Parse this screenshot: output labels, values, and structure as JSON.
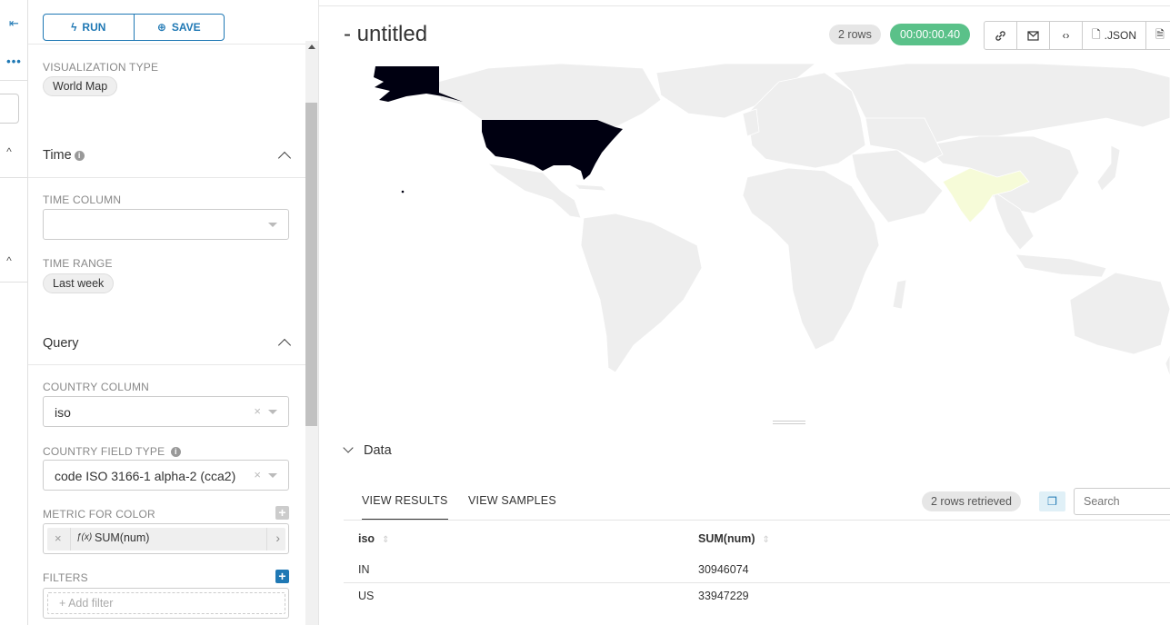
{
  "panel": {
    "run_label": "RUN",
    "save_label": "SAVE",
    "viz_type_label": "VISUALIZATION TYPE",
    "viz_type_value": "World Map",
    "time_section": "Time",
    "time_column_label": "TIME COLUMN",
    "time_column_value": "",
    "time_range_label": "TIME RANGE",
    "time_range_value": "Last week",
    "query_section": "Query",
    "country_column_label": "COUNTRY COLUMN",
    "country_column_value": "iso",
    "country_field_type_label": "COUNTRY FIELD TYPE",
    "country_field_type_value": "code ISO 3166-1 alpha-2 (cca2)",
    "metric_label": "METRIC FOR COLOR",
    "metric_value": "SUM(num)",
    "metric_fx": "ƒ(x)",
    "filters_label": "FILTERS",
    "add_filter_placeholder": "Add filter"
  },
  "header": {
    "title": "- untitled",
    "rows_badge": "2 rows",
    "timer": "00:00:00.40",
    "json_label": ".JSON"
  },
  "data_section": {
    "title": "Data",
    "tabs": [
      "VIEW RESULTS",
      "VIEW SAMPLES"
    ],
    "retrieved": "2 rows retrieved",
    "search_placeholder": "Search",
    "columns": [
      "iso",
      "SUM(num)"
    ],
    "rows": [
      [
        "IN",
        "30946074"
      ],
      [
        "US",
        "33947229"
      ]
    ]
  },
  "colors": {
    "accent": "#1f78b4",
    "timer": "#5ac189",
    "us": "#000011",
    "in": "#f6fbd8",
    "land": "#eeeeee"
  },
  "icons": {
    "collapse": "collapse-left-icon",
    "more": "more-dots-icon",
    "run": "bolt-icon",
    "save": "plus-circle-icon",
    "info": "info-icon",
    "link": "link-icon",
    "email": "mail-icon",
    "embed": "code-icon",
    "json": "file-icon",
    "csv": "file-icon",
    "copy": "copy-icon"
  }
}
